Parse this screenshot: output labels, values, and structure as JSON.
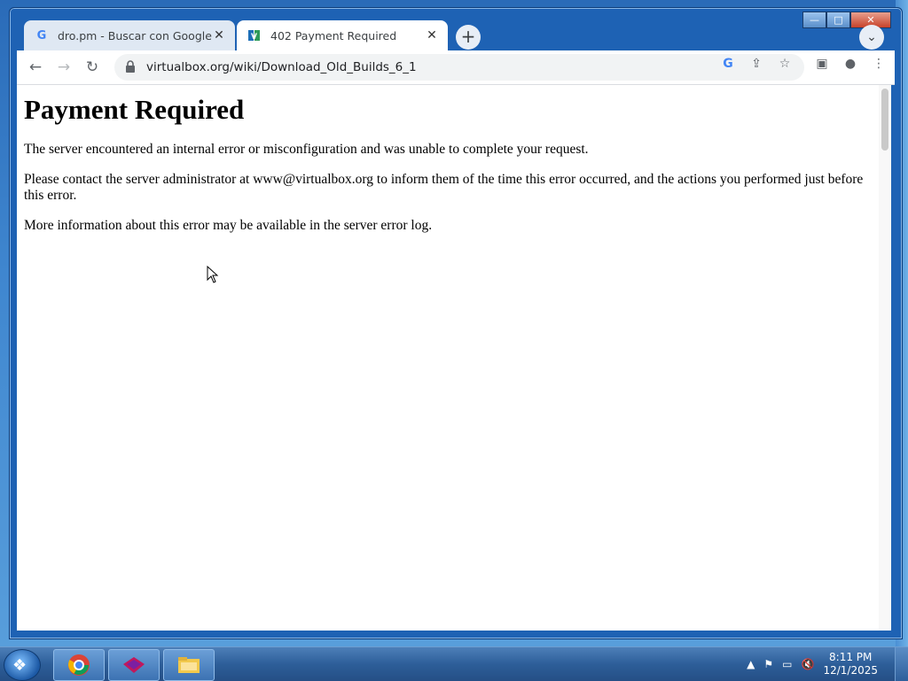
{
  "browser": {
    "tabs": [
      {
        "title": "dro.pm - Buscar con Google",
        "favicon": "google-g-icon",
        "active": false
      },
      {
        "title": "402 Payment Required",
        "favicon": "virtualbox-icon",
        "active": true
      }
    ],
    "url": "virtualbox.org/wiki/Download_Old_Builds_6_1",
    "window_controls": {
      "minimize": "—",
      "maximize": "□",
      "close": "✕"
    }
  },
  "page": {
    "heading": "Payment Required",
    "paragraphs": [
      "The server encountered an internal error or misconfiguration and was unable to complete your request.",
      "Please contact the server administrator at www@virtualbox.org to inform them of the time this error occurred, and the actions you performed just before this error.",
      "More information about this error may be available in the server error log."
    ]
  },
  "taskbar": {
    "apps": [
      "chrome-icon",
      "app-icon",
      "file-explorer-icon"
    ],
    "clock": {
      "time": "8:11 PM",
      "date": "12/1/2025"
    }
  },
  "colors": {
    "accent": "#1e62b4",
    "taskbar": "#2d5e99"
  }
}
